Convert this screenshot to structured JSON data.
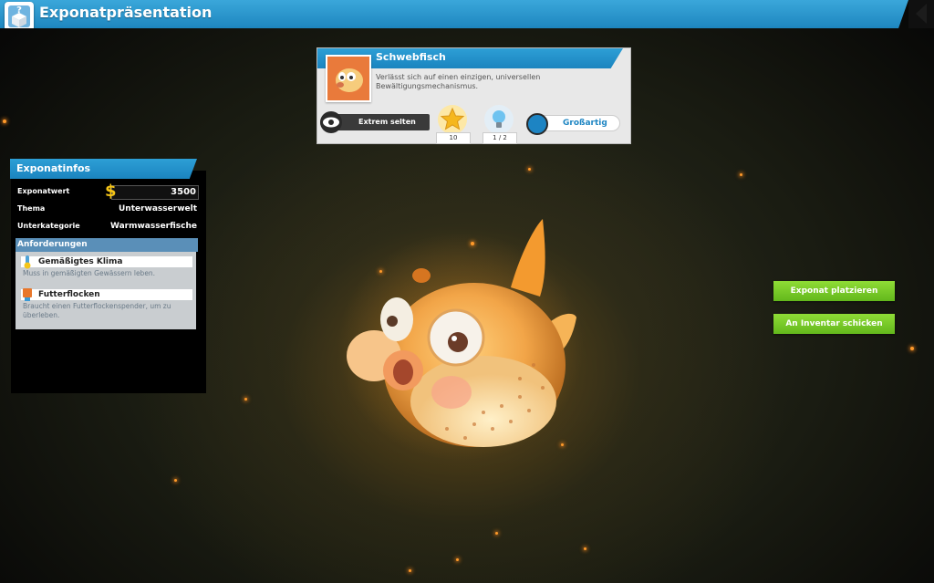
{
  "header": {
    "title": "Exponatpräsentation",
    "icon": "exhibit-box-icon"
  },
  "card": {
    "name": "Schwebfisch",
    "description": "Verlässt sich auf einen einzigen, universellen Bewältigungsmechanismus.",
    "rarity": "Extrem selten",
    "star_value": "10",
    "research_value": "1 / 2",
    "quality": "Großartig",
    "thumbnail_icon": "pufferfish-icon"
  },
  "panel": {
    "title": "Exponatinfos",
    "rows": [
      {
        "label": "Exponatwert",
        "value": "3500"
      },
      {
        "label": "Thema",
        "value": "Unterwasserwelt"
      },
      {
        "label": "Unterkategorie",
        "value": "Warmwasserfische"
      }
    ],
    "requirements_title": "Anforderungen",
    "requirements": [
      {
        "label": "Gemäßigtes Klima",
        "desc": "Muss in gemäßigten Gewässern leben.",
        "icon": "thermometer-icon"
      },
      {
        "label": "Futterflocken",
        "desc": "Braucht einen Futterflockenspender, um zu überleben.",
        "icon": "food-dispenser-icon"
      }
    ]
  },
  "actions": {
    "place": "Exponat platzieren",
    "inventory": "An Inventar schicken"
  },
  "colors": {
    "accent_blue": "#1e86bf",
    "button_green": "#6cc21f",
    "spark_orange": "#ff9a2a"
  }
}
